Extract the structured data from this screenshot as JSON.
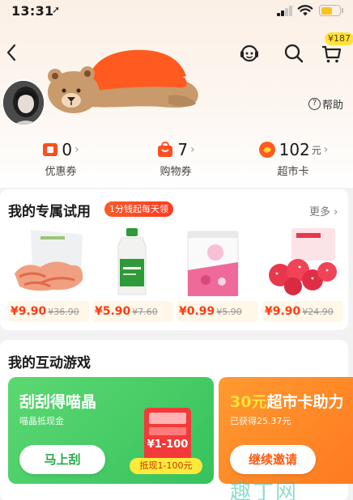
{
  "status_bar": {
    "time": "13:31",
    "location_arrow": "➚"
  },
  "nav": {
    "back_icon": "chevron-left-icon",
    "service_icon": "customer-service-icon",
    "search_icon": "search-icon",
    "cart_icon": "cart-icon",
    "cart_badge": "¥187"
  },
  "profile": {
    "help_label": "帮助"
  },
  "stats": [
    {
      "value": "0",
      "unit": "",
      "label": "优惠券",
      "icon": "coupon-icon"
    },
    {
      "value": "7",
      "unit": "",
      "label": "购物券",
      "icon": "shopping-bag-icon"
    },
    {
      "value": "102",
      "unit": "元",
      "label": "超市卡",
      "icon": "market-card-icon"
    }
  ],
  "trial": {
    "title": "我的专属试用",
    "tag": "1分钱起每天领",
    "more": "更多",
    "products": [
      {
        "price": "¥9.90",
        "original": "¥36.90"
      },
      {
        "price": "¥5.90",
        "original": "¥7.60"
      },
      {
        "price": "¥0.99",
        "original": "¥5.90"
      },
      {
        "price": "¥9.90",
        "original": "¥24.90"
      }
    ]
  },
  "games": {
    "title": "我的互动游戏",
    "card1": {
      "title": "刮刮得喵晶",
      "subtitle": "喵晶抵现金",
      "prize": "¥1-100",
      "prize_note": "抵现1-100元",
      "button": "马上刮"
    },
    "card2": {
      "title_highlight": "30元",
      "title_rest": "超市卡助力",
      "subtitle": "已获得25.37元",
      "button": "继续邀请"
    }
  },
  "watermark": "趣丁网",
  "colors": {
    "accent_red": "#ff3b16",
    "green_card": "#3dc864",
    "orange_card": "#ff8a1e"
  }
}
